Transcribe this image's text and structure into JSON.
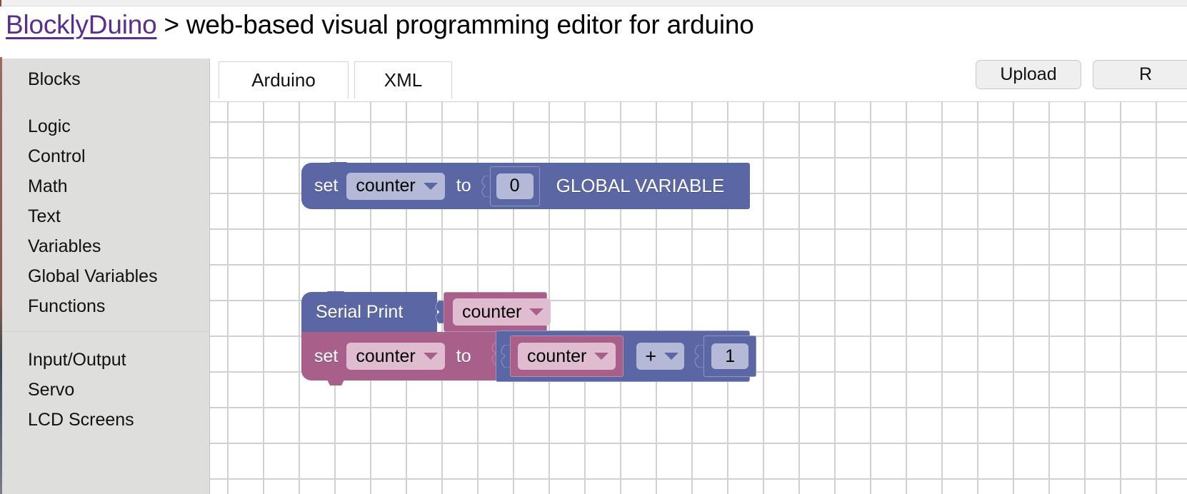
{
  "page": {
    "brand": "BlocklyDuino",
    "separator": ">",
    "tagline": "web-based visual programming editor for arduino"
  },
  "toolbox": {
    "header": "Blocks",
    "groups": [
      {
        "items": [
          {
            "label": "Logic"
          },
          {
            "label": "Control"
          },
          {
            "label": "Math"
          },
          {
            "label": "Text"
          },
          {
            "label": "Variables"
          },
          {
            "label": "Global Variables"
          },
          {
            "label": "Functions"
          }
        ]
      },
      {
        "items": [
          {
            "label": "Input/Output"
          },
          {
            "label": "Servo"
          },
          {
            "label": "LCD Screens"
          }
        ]
      }
    ]
  },
  "tabs": [
    {
      "label": "Arduino",
      "selected": false
    },
    {
      "label": "XML",
      "selected": false
    }
  ],
  "toolbar": {
    "upload_label": "Upload",
    "reset_label": "R"
  },
  "colors": {
    "block_blue": "#5b67a5",
    "block_pink": "#a8608a",
    "field_on_blue": "#b3b9d6",
    "field_on_pink": "#e0bcd0",
    "toolbox_bg": "#dededc",
    "brand_link": "#5b2d8e",
    "grid_dot": "#cfcfcf"
  },
  "workspace": {
    "blocks": [
      {
        "id": "global-var-set",
        "type": "global_variable_set",
        "color": "block_blue",
        "set_label": "set",
        "variable": "counter",
        "to_label": "to",
        "value": "0",
        "trailing_label": "GLOBAL VARIABLE"
      },
      {
        "id": "serial-print",
        "type": "serial_print",
        "color": "block_blue",
        "label": "Serial Print",
        "argument_variable": "counter"
      },
      {
        "id": "variable-set-increment",
        "type": "variables_set",
        "color": "block_pink",
        "set_label": "set",
        "variable": "counter",
        "to_label": "to",
        "operand_left": "counter",
        "operator": "+",
        "operand_right": "1"
      }
    ]
  }
}
